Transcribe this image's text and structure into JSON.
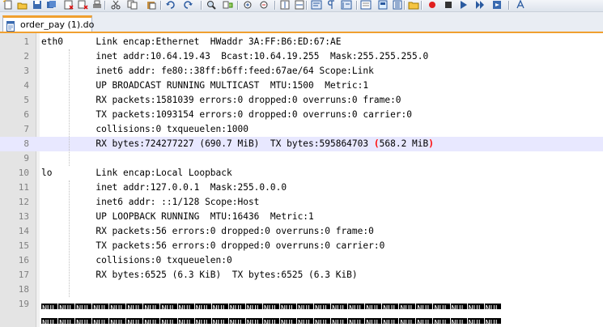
{
  "toolbar": {
    "icons": [
      "new-file-icon",
      "open-file-icon",
      "save-icon",
      "save-all-icon",
      "close-icon",
      "close-all-icon",
      "print-icon",
      "cut-icon",
      "copy-icon",
      "paste-icon",
      "undo-icon",
      "redo-icon",
      "find-icon",
      "replace-icon",
      "zoom-in-icon",
      "zoom-out-icon",
      "sync-v-icon",
      "sync-h-icon",
      "word-wrap-icon",
      "show-all-chars-icon",
      "indent-guide-icon",
      "user-lang-icon",
      "doc-map-icon",
      "function-list-icon",
      "folder-workspace-icon",
      "record-macro-icon",
      "stop-record-icon",
      "playback-icon",
      "run-macro-icon",
      "save-macro-icon",
      "spell-check-icon"
    ]
  },
  "tab": {
    "label": "order_pay (1).do",
    "icon": "document-icon"
  },
  "editor": {
    "current_line": 8,
    "lines": [
      {
        "num": "1",
        "text": "eth0      Link encap:Ethernet  HWaddr 3A:FF:B6:ED:67:AE"
      },
      {
        "num": "2",
        "text": "          inet addr:10.64.19.43  Bcast:10.64.19.255  Mask:255.255.255.0"
      },
      {
        "num": "3",
        "text": "          inet6 addr: fe80::38ff:b6ff:feed:67ae/64 Scope:Link"
      },
      {
        "num": "4",
        "text": "          UP BROADCAST RUNNING MULTICAST  MTU:1500  Metric:1"
      },
      {
        "num": "5",
        "text": "          RX packets:1581039 errors:0 dropped:0 overruns:0 frame:0"
      },
      {
        "num": "6",
        "text": "          TX packets:1093154 errors:0 dropped:0 overruns:0 carrier:0"
      },
      {
        "num": "7",
        "text": "          collisions:0 txqueuelen:1000"
      },
      {
        "num": "8",
        "text": "          RX bytes:724277227 (690.7 MiB)  TX bytes:595864703 ",
        "hl_open": "(",
        "hl_mid": "568.2 MiB",
        "hl_close": ")"
      },
      {
        "num": "9",
        "text": ""
      },
      {
        "num": "10",
        "text": "lo        Link encap:Local Loopback"
      },
      {
        "num": "11",
        "text": "          inet addr:127.0.0.1  Mask:255.0.0.0"
      },
      {
        "num": "12",
        "text": "          inet6 addr: ::1/128 Scope:Host"
      },
      {
        "num": "13",
        "text": "          UP LOOPBACK RUNNING  MTU:16436  Metric:1"
      },
      {
        "num": "14",
        "text": "          RX packets:56 errors:0 dropped:0 overruns:0 frame:0"
      },
      {
        "num": "15",
        "text": "          TX packets:56 errors:0 dropped:0 overruns:0 carrier:0"
      },
      {
        "num": "16",
        "text": "          collisions:0 txqueuelen:0"
      },
      {
        "num": "17",
        "text": "          RX bytes:6525 (6.3 KiB)  TX bytes:6525 (6.3 KiB)"
      },
      {
        "num": "18",
        "text": ""
      },
      {
        "num": "19",
        "text": ""
      }
    ],
    "nul_token": "NUL"
  }
}
